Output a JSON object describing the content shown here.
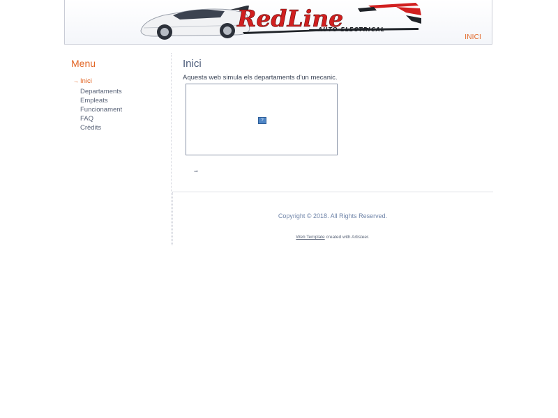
{
  "header": {
    "logo_text": "RedLine",
    "logo_subtext": "AUTO ELECTRICAL",
    "nav_inici": "INICI"
  },
  "sidebar": {
    "title": "Menu",
    "items": [
      {
        "label": "Inici",
        "active": true
      },
      {
        "label": "Departaments"
      },
      {
        "label": "Empleats"
      },
      {
        "label": "Funcionament"
      },
      {
        "label": "FAQ"
      },
      {
        "label": "Crèdits"
      }
    ]
  },
  "main": {
    "title": "Inici",
    "description": "Aquesta web simula els departaments d'un mecanic.",
    "embed_placeholder": "?"
  },
  "footer": {
    "copyright": "Copyright © 2018. All Rights Reserved.",
    "template_link": "Web Template",
    "template_rest": "created with Artisteer."
  },
  "colors": {
    "accent": "#e26524",
    "brand_red": "#d11f1f",
    "text": "#3a4456",
    "muted": "#5a6478"
  },
  "icons": {
    "menu_active": "arrow-right-icon",
    "embed": "broken-plugin-icon",
    "small_arrow": "double-arrow-icon"
  }
}
